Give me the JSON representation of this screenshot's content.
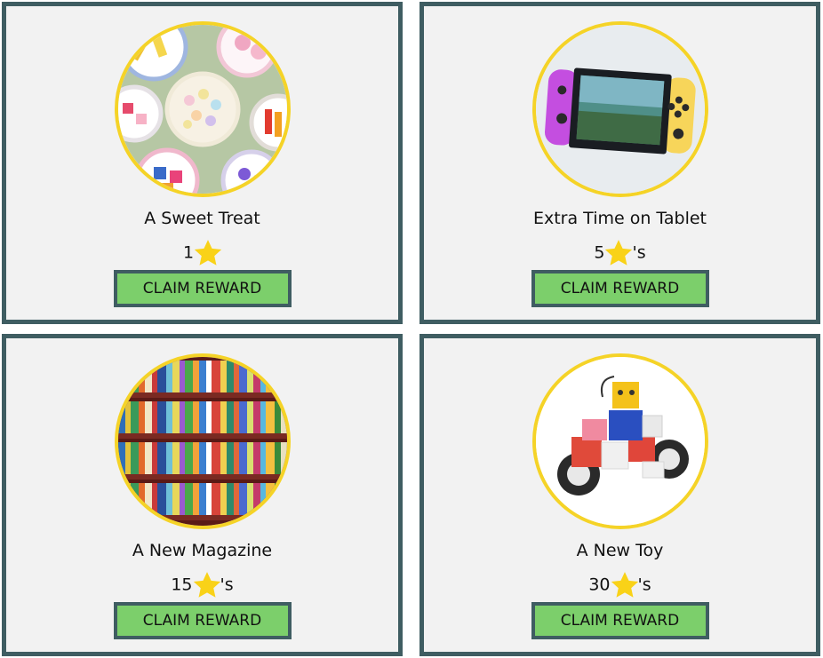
{
  "rewards": [
    {
      "title": "A Sweet Treat",
      "cost": "1",
      "cost_suffix": "",
      "button_label": "CLAIM REWARD",
      "image_subject": "bowls of colorful candy"
    },
    {
      "title": "Extra Time on Tablet",
      "cost": "5",
      "cost_suffix": "'s",
      "button_label": "CLAIM REWARD",
      "image_subject": "handheld game console"
    },
    {
      "title": "A New Magazine",
      "cost": "15",
      "cost_suffix": "'s",
      "button_label": "CLAIM REWARD",
      "image_subject": "bookshelf full of books"
    },
    {
      "title": "A New Toy",
      "cost": "30",
      "cost_suffix": "'s",
      "button_label": "CLAIM REWARD",
      "image_subject": "robot building block toy car"
    }
  ],
  "icons": {
    "cost_icon": "star-icon"
  },
  "colors": {
    "card_border": "#3f5d62",
    "card_background": "#f2f2f2",
    "image_ring": "#f5d327",
    "button_fill": "#7ccf6b",
    "star": "#f9d218"
  }
}
